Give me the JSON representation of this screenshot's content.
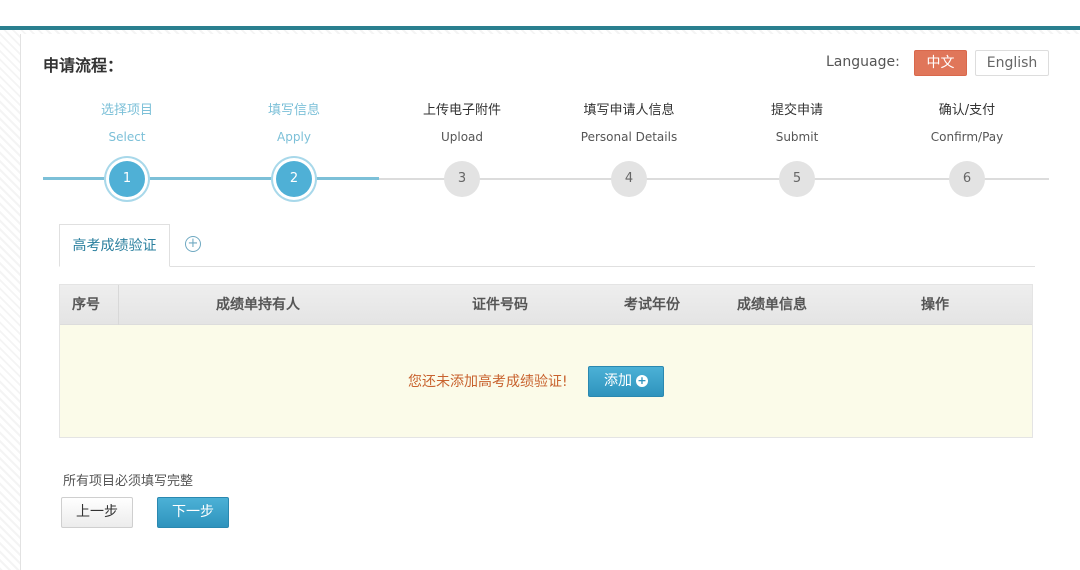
{
  "header": {
    "flow_title": "申请流程：",
    "language_label": "Language:",
    "lang_zh": "中文",
    "lang_en": "English"
  },
  "steps": [
    {
      "cn": "选择项目",
      "en": "Select",
      "num": "1",
      "status": "done"
    },
    {
      "cn": "填写信息",
      "en": "Apply",
      "num": "2",
      "status": "done"
    },
    {
      "cn": "上传电子附件",
      "en": "Upload",
      "num": "3",
      "status": "todo"
    },
    {
      "cn": "填写申请人信息",
      "en": "Personal Details",
      "num": "4",
      "status": "todo"
    },
    {
      "cn": "提交申请",
      "en": "Submit",
      "num": "5",
      "status": "todo"
    },
    {
      "cn": "确认/支付",
      "en": "Confirm/Pay",
      "num": "6",
      "status": "todo"
    }
  ],
  "tabs": {
    "active_label": "高考成绩验证",
    "add_icon": "plus-circle-icon"
  },
  "table": {
    "columns": [
      "序号",
      "成绩单持有人",
      "证件号码",
      "考试年份",
      "成绩单信息",
      "操作"
    ],
    "empty_message": "您还未添加高考成绩验证!",
    "add_label": "添加"
  },
  "footer": {
    "required_note": "所有项目必须填写完整",
    "prev_label": "上一步",
    "next_label": "下一步"
  },
  "colors": {
    "accent": "#4fb0d6",
    "top_bar": "#2a7f8f",
    "lang_active": "#e0765a",
    "empty_row_bg": "#fbfbe9"
  }
}
